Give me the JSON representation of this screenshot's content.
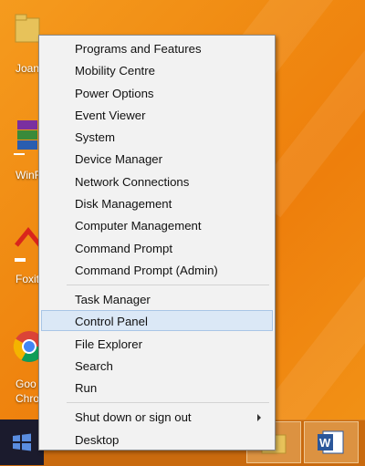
{
  "desktop": {
    "icons": [
      {
        "name": "folder-icon",
        "label": "Joan"
      },
      {
        "name": "winrar-icon",
        "label": "WinR"
      },
      {
        "name": "foxit-icon",
        "label": "Foxit"
      },
      {
        "name": "chrome-icon",
        "label": "Goo",
        "label2": "Chro"
      }
    ]
  },
  "menu": {
    "group1": [
      "Programs and Features",
      "Mobility Centre",
      "Power Options",
      "Event Viewer",
      "System",
      "Device Manager",
      "Network Connections",
      "Disk Management",
      "Computer Management",
      "Command Prompt",
      "Command Prompt (Admin)"
    ],
    "group2": [
      "Task Manager",
      "Control Panel",
      "File Explorer",
      "Search",
      "Run"
    ],
    "group3": [
      "Shut down or sign out",
      "Desktop"
    ],
    "selected": "Control Panel"
  },
  "colors": {
    "accent": "#ee7f0c",
    "selection": "#dbe8f6",
    "start": "#1b1b2d"
  },
  "taskbar": {
    "pinned": [
      "start-icon",
      "folder-icon",
      "word-icon"
    ]
  }
}
